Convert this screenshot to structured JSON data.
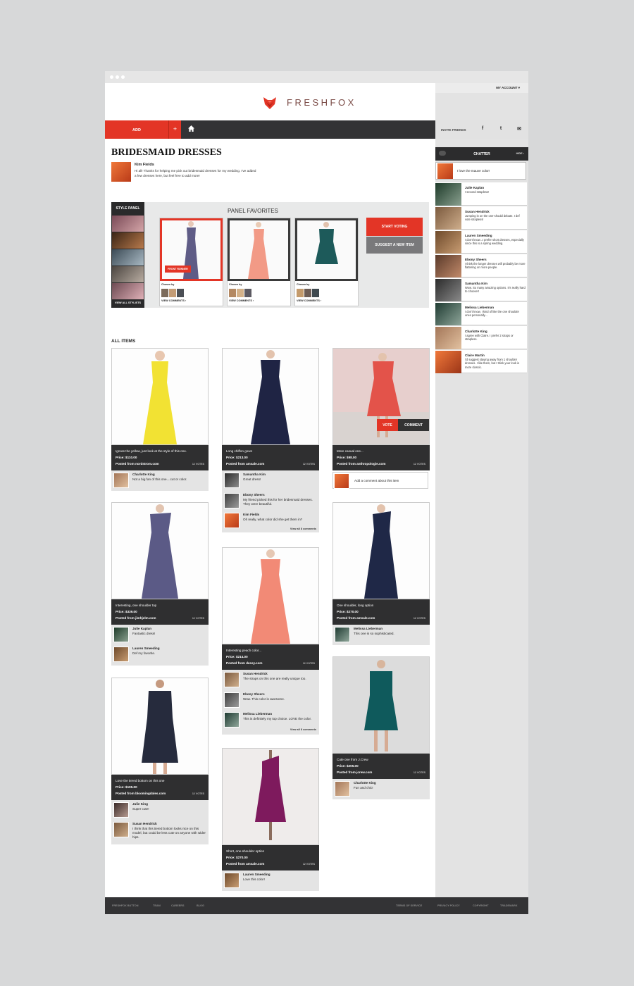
{
  "account": {
    "label": "MY ACCOUNT"
  },
  "brand": {
    "name": "FRESHFOX",
    "color": "#e33526",
    "dark": "#333335"
  },
  "nav": {
    "add_label": "ADD",
    "plus_label": "+",
    "home_icon": "home-icon",
    "invite_label": "INVITE FRIENDS",
    "social": [
      "f",
      "t",
      "✉"
    ]
  },
  "board": {
    "title": "BRIDESMAID DRESSES",
    "author": "Kim Fields",
    "intro": "Hi all! Thanks for helping me pick out bridesmaid dresses for my wedding. I've added a few dresses here, but feel free to add more!"
  },
  "style_panel": {
    "title": "STYLE PANEL",
    "view_all": "VIEW ALL STYLISTS"
  },
  "panel_favorites": {
    "title": "PANEL FAVORITES",
    "front_runner": "FRONT RUNNER",
    "chosen_by": "Chosen by",
    "view_comments": "VIEW COMMENTS ›",
    "start_voting": "START VOTING",
    "suggest": "SUGGEST A NEW ITEM"
  },
  "all_items_title": "ALL ITEMS",
  "vote_label": "VOTE",
  "comment_label": "COMMENT",
  "add_comment_placeholder": "Add a comment about this item",
  "items": [
    {
      "desc": "Ignore the yellow, just look at the style of this one.",
      "price": "Price: $110.00",
      "source": "Posted from nordstrom.com",
      "votes": "12 VOTES",
      "comments": [
        {
          "name": "Charlotte King",
          "text": "Not a big fan of this one....cut or color."
        }
      ]
    },
    {
      "desc": "Long chiffon gown",
      "price": "Price: $213.00",
      "source": "Posted from amsale.com",
      "votes": "12 VOTES",
      "comments": [
        {
          "name": "Samantha Kim",
          "text": "Great dress!"
        },
        {
          "name": "Ebony Sheers",
          "text": "My friend picked this for her bridesmaid dresses. They were beautiful."
        },
        {
          "name": "Kim Fields",
          "text": "Oh really, what color did she get them in?"
        }
      ],
      "view_all": "View all 8 comments"
    },
    {
      "desc": "More casual one...",
      "price": "Price: $98.00",
      "source": "Posted from anthropologie.com",
      "votes": "12 VOTES"
    },
    {
      "desc": "Interesting, one shoulder top",
      "price": "Price: $339.00",
      "source": "Posted from jimhjelm.com",
      "votes": "12 VOTES",
      "comments": [
        {
          "name": "Julie Kaplan",
          "text": "Fantastic dress!"
        },
        {
          "name": "Lauren Smeeding",
          "text": "Def my favorite."
        }
      ]
    },
    {
      "desc": "Interesting peach color...",
      "price": "Price: $214.00",
      "source": "Posted from dessy.com",
      "votes": "12 VOTES",
      "comments": [
        {
          "name": "Susan Hendrick",
          "text": "The straps on this one are really unique too."
        },
        {
          "name": "Ebony Sheers",
          "text": "Wow. This color is awesome."
        },
        {
          "name": "Melissa Lieberman",
          "text": "This is definitely my top choice. LOVE the color."
        }
      ],
      "view_all": "View all 8 comments"
    },
    {
      "desc": "One shoulder, long option",
      "price": "Price: $270.00",
      "source": "Posted from amsale.com",
      "votes": "12 VOTES",
      "comments": [
        {
          "name": "Melissa Lieberman",
          "text": "This one is so sophisticated."
        }
      ]
    },
    {
      "desc": "Love the tiered bottom on this one",
      "price": "Price: $195.00",
      "source": "Posted from bloomingdales.com",
      "votes": "12 VOTES",
      "comments": [
        {
          "name": "Julie King",
          "text": "Super cute!"
        },
        {
          "name": "Susan Hendrick",
          "text": "I think that this tiered bottom looks nice on this model, but could be less cute on anyone with wider hips."
        }
      ]
    },
    {
      "desc": "Short, one-shoulder option",
      "price": "Price: $270.00",
      "source": "Posted from amsale.com",
      "votes": "12 VOTES",
      "comments": [
        {
          "name": "Lauren Smeeding",
          "text": "Love this color!"
        }
      ]
    },
    {
      "desc": "Cute one from J.Crew",
      "price": "Price: $205.00",
      "source": "Posted from jcrew.com",
      "votes": "12 VOTES",
      "comments": [
        {
          "name": "Charlotte King",
          "text": "Fun and chic!"
        }
      ]
    }
  ],
  "chatter": {
    "title": "CHATTER",
    "hide": "HIDE ›",
    "input_text": "I love the mauve color!",
    "messages": [
      {
        "name": "Julie Kaplan",
        "text": "I second strapless!"
      },
      {
        "name": "Susan Hendrick",
        "text": "Jumping in on the one-should debate. I def vote strapless!"
      },
      {
        "name": "Lauren Smeeding",
        "text": "I don't know...I prefer short dresses, especially since this is a spring wedding."
      },
      {
        "name": "Ebony Sheers",
        "text": "I think the longer dresses will probably be more flattering on more people."
      },
      {
        "name": "Samantha Kim",
        "text": "Wow. So many amazing options. It's really hard to choose!!"
      },
      {
        "name": "Melissa Lieberman",
        "text": "I don't know, I kind of like the one shoulder ones personally..."
      },
      {
        "name": "Charlotte King",
        "text": "I agree with Claire. I prefer 2 straps or strapless."
      },
      {
        "name": "Claire Martin",
        "text": "I'd suggest staying away from 1 shoulder dresses. I like them, but I think your look is more classic."
      }
    ]
  },
  "footer": {
    "left": [
      "FRESHFOX BUTTON",
      "TEAM",
      "CAREERS",
      "BLOG"
    ],
    "right": [
      "TERMS OF SERVICE",
      "PRIVACY POLICY",
      "COPYRIGHT",
      "TRADEMARK"
    ]
  }
}
